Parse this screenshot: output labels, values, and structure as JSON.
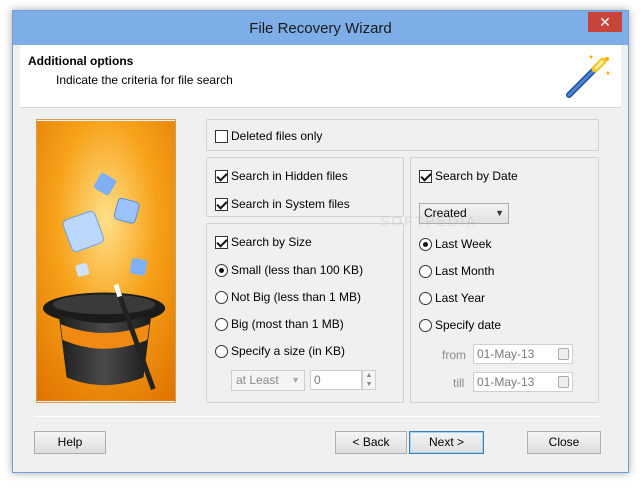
{
  "window": {
    "title": "File Recovery Wizard",
    "close_glyph": "✕"
  },
  "header": {
    "title": "Additional options",
    "subtitle": "Indicate the criteria for file search",
    "icon": "magic-wand-icon"
  },
  "art": {
    "icon": "magic-hat-illustration"
  },
  "options": {
    "deleted_only": {
      "label": "Deleted files only",
      "checked": false
    },
    "hidden_files": {
      "label": "Search in Hidden files",
      "checked": true
    },
    "system_files": {
      "label": "Search in System files",
      "checked": true
    }
  },
  "size": {
    "label": "Search by Size",
    "checked": true,
    "choices": [
      {
        "label": "Small (less than 100 KB)",
        "selected": true
      },
      {
        "label": "Not Big (less than 1 MB)",
        "selected": false
      },
      {
        "label": "Big (most than 1 MB)",
        "selected": false
      },
      {
        "label": "Specify a size (in KB)",
        "selected": false
      }
    ],
    "mode_select": "at Least",
    "size_value": "0"
  },
  "date": {
    "label": "Search by Date",
    "checked": true,
    "type_select": "Created",
    "choices": [
      {
        "label": "Last Week",
        "selected": true
      },
      {
        "label": "Last Month",
        "selected": false
      },
      {
        "label": "Last Year",
        "selected": false
      },
      {
        "label": "Specify date",
        "selected": false
      }
    ],
    "from_label": "from",
    "from_value": "01-May-13",
    "till_label": "till",
    "till_value": "01-May-13"
  },
  "buttons": {
    "help": "Help",
    "back": "< Back",
    "next": "Next >",
    "close": "Close"
  },
  "watermark": "SOFTPEDIA",
  "colors": {
    "titlebar": "#7eaee8",
    "close": "#c7443a",
    "accent": "#3c7fb1"
  }
}
